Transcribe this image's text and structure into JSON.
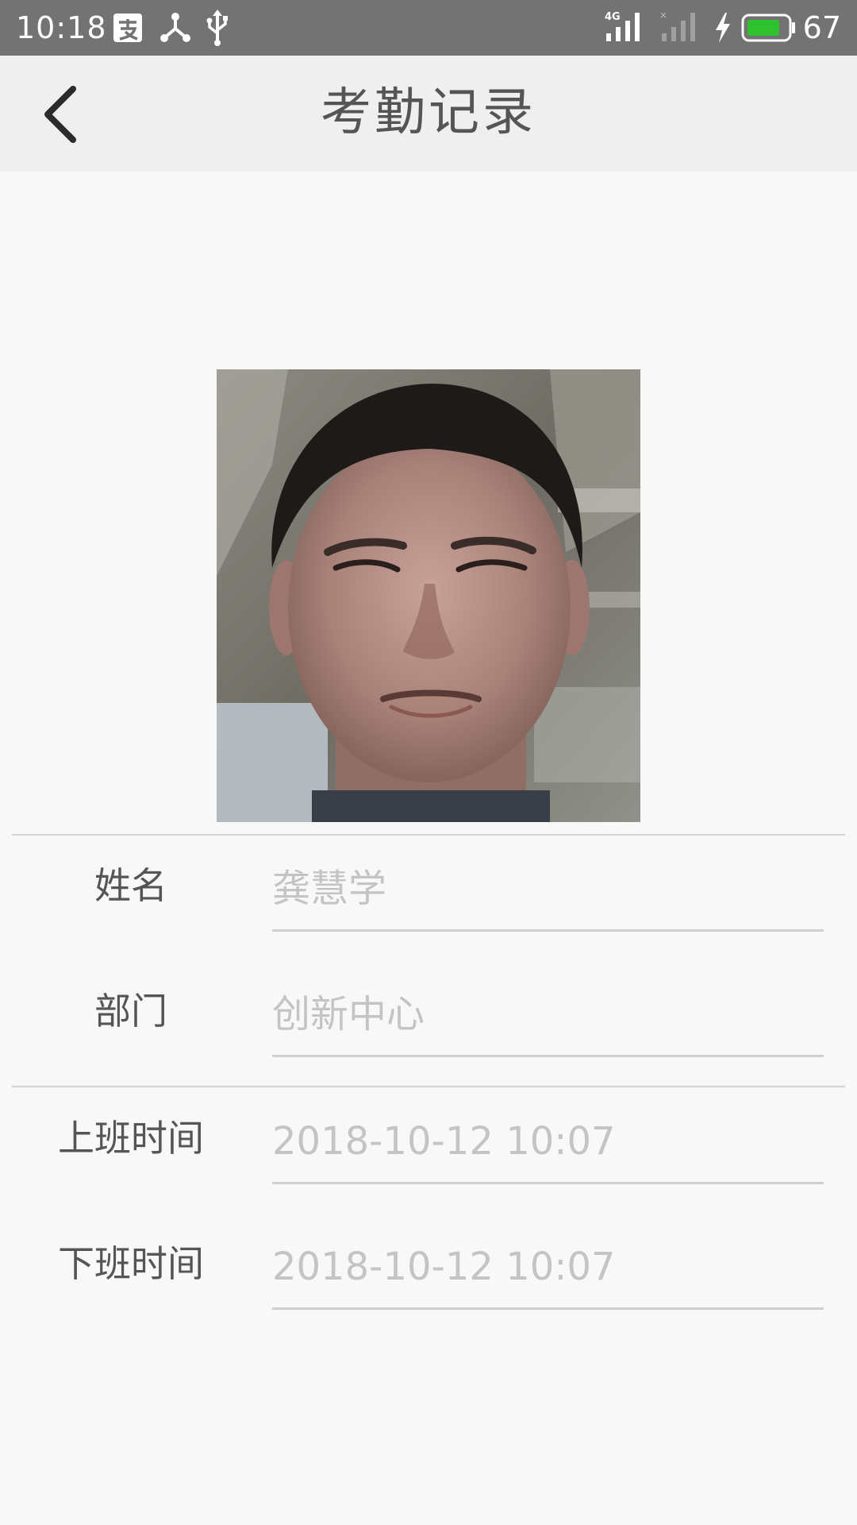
{
  "status_bar": {
    "time": "10:18",
    "network": "4G",
    "battery": "67",
    "icons": [
      "alipay-icon",
      "share-icon",
      "usb-icon",
      "signal-icon",
      "signal-weak-icon",
      "charging-icon",
      "battery-icon"
    ]
  },
  "header": {
    "title": "考勤记录",
    "back_icon": "back-arrow-icon"
  },
  "profile": {
    "photo": "face-photo"
  },
  "form": {
    "name": {
      "label": "姓名",
      "value": "龚慧学"
    },
    "department": {
      "label": "部门",
      "value": "创新中心"
    },
    "clock_in": {
      "label": "上班时间",
      "value": "2018-10-12 10:07"
    },
    "clock_out": {
      "label": "下班时间",
      "value": "2018-10-12 10:07"
    }
  },
  "colors": {
    "status_bar": "#737373",
    "header_bg": "#efefef",
    "page_bg": "#f8f8f8",
    "battery_fill": "#2fc22f"
  }
}
